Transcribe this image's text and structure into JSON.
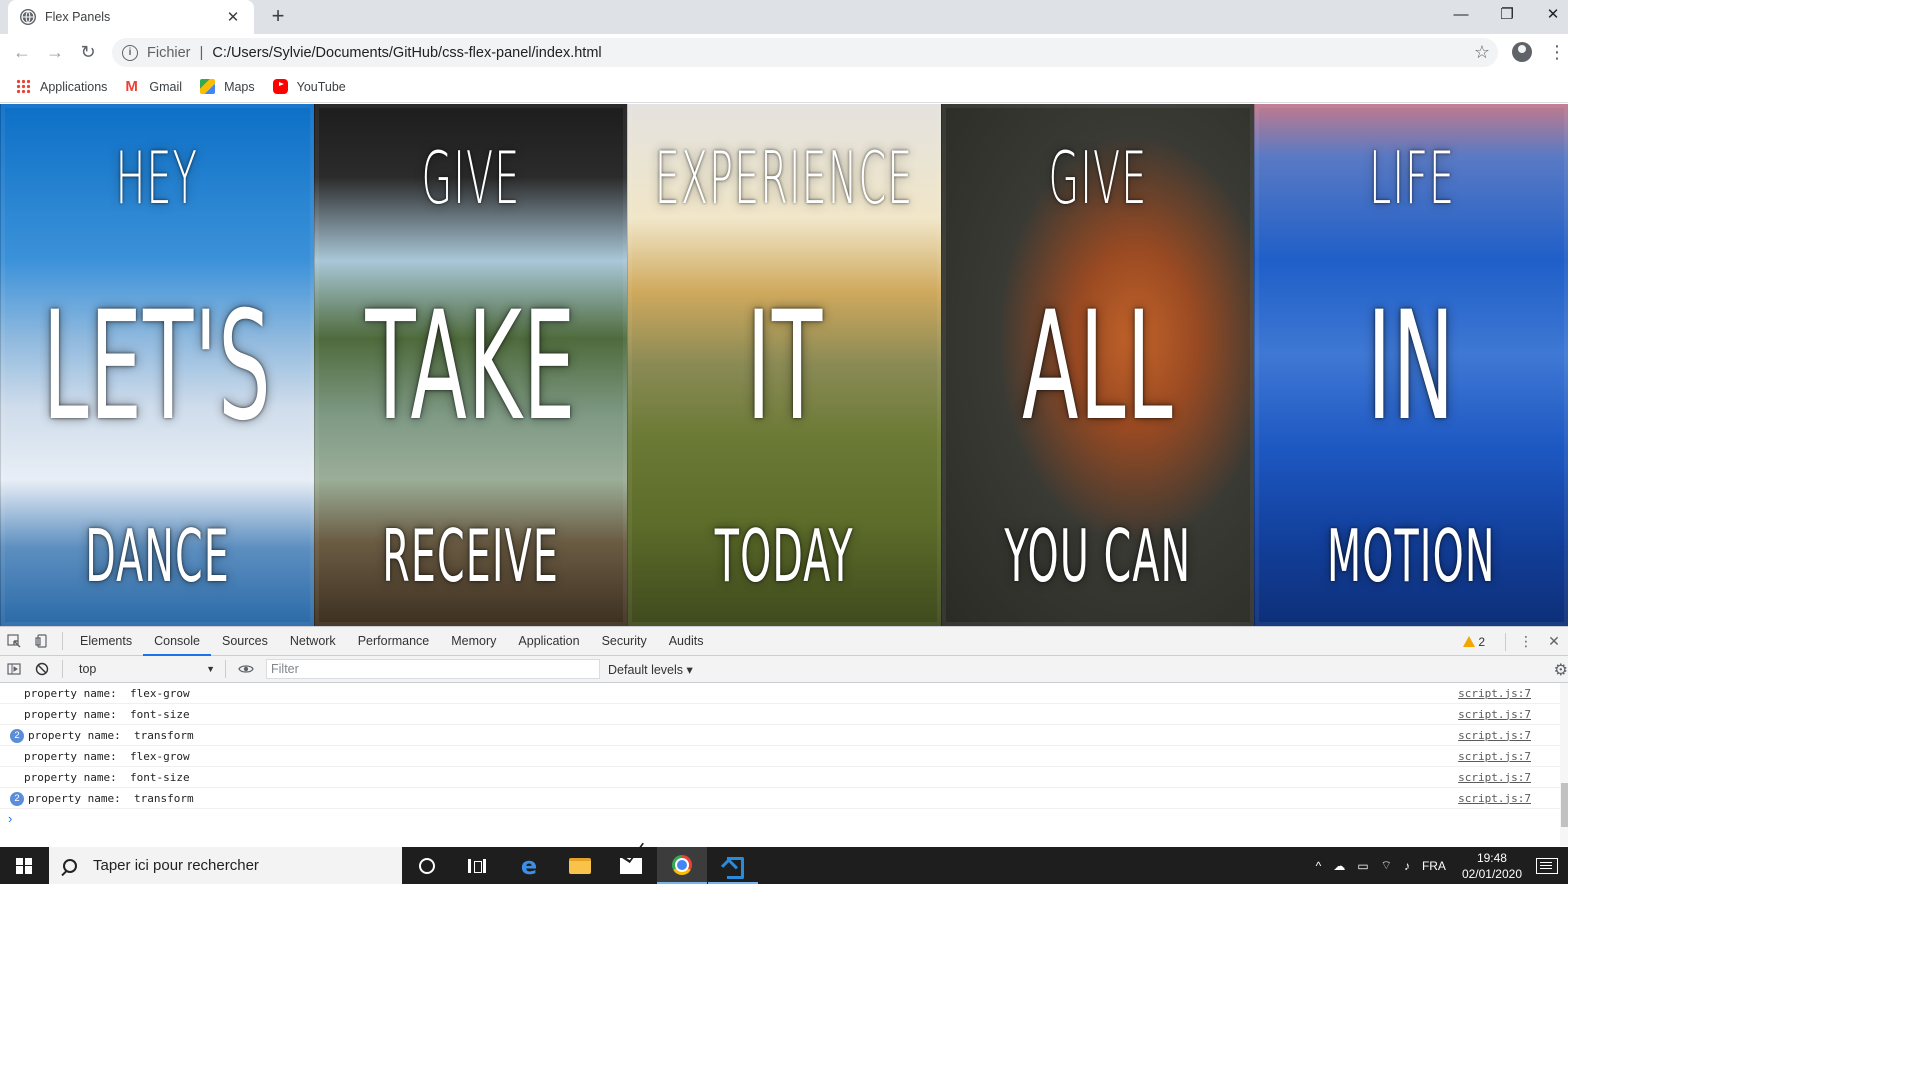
{
  "browser": {
    "tab_title": "Flex Panels",
    "tab_close": "✕",
    "new_tab": "+",
    "window_controls": {
      "minimize": "—",
      "restore": "❐",
      "close": "✕"
    },
    "nav": {
      "back": "←",
      "forward": "→",
      "reload": "↻"
    },
    "address": {
      "scheme_label": "Fichier",
      "separator": "|",
      "url": "C:/Users/Sylvie/Documents/GitHub/css-flex-panel/index.html",
      "bookmark_star": "☆"
    },
    "menu": "⋮",
    "bookmarks": [
      {
        "label": "Applications",
        "icon": "apps-icon"
      },
      {
        "label": "Gmail",
        "icon": "gmail-icon"
      },
      {
        "label": "Maps",
        "icon": "maps-icon"
      },
      {
        "label": "YouTube",
        "icon": "youtube-icon"
      }
    ]
  },
  "panels": [
    {
      "top": "Hey",
      "middle": "Let's",
      "bottom": "Dance"
    },
    {
      "top": "Give",
      "middle": "Take",
      "bottom": "Receive"
    },
    {
      "top": "Experience",
      "middle": "It",
      "bottom": "Today"
    },
    {
      "top": "Give",
      "middle": "All",
      "bottom": "You can"
    },
    {
      "top": "Life",
      "middle": "In",
      "bottom": "Motion"
    }
  ],
  "devtools": {
    "tabs": [
      "Elements",
      "Console",
      "Sources",
      "Network",
      "Performance",
      "Memory",
      "Application",
      "Security",
      "Audits"
    ],
    "active_tab": "Console",
    "warning_count": "2",
    "menu": "⋮",
    "close": "✕",
    "context": "top",
    "context_arrow": "▼",
    "filter_placeholder": "Filter",
    "levels": "Default levels ▾",
    "gear": "⚙",
    "prompt": "›",
    "logs": [
      {
        "count": "",
        "message": "property name:  flex-grow",
        "source": "script.js:7"
      },
      {
        "count": "",
        "message": "property name:  font-size",
        "source": "script.js:7"
      },
      {
        "count": "2",
        "message": "property name:  transform",
        "source": "script.js:7"
      },
      {
        "count": "",
        "message": "property name:  flex-grow",
        "source": "script.js:7"
      },
      {
        "count": "",
        "message": "property name:  font-size",
        "source": "script.js:7"
      },
      {
        "count": "2",
        "message": "property name:  transform",
        "source": "script.js:7"
      }
    ]
  },
  "taskbar": {
    "search_placeholder": "Taper ici pour rechercher",
    "tray": {
      "up_arrow": "^",
      "language": "FRA",
      "time": "19:48",
      "date": "02/01/2020"
    }
  }
}
